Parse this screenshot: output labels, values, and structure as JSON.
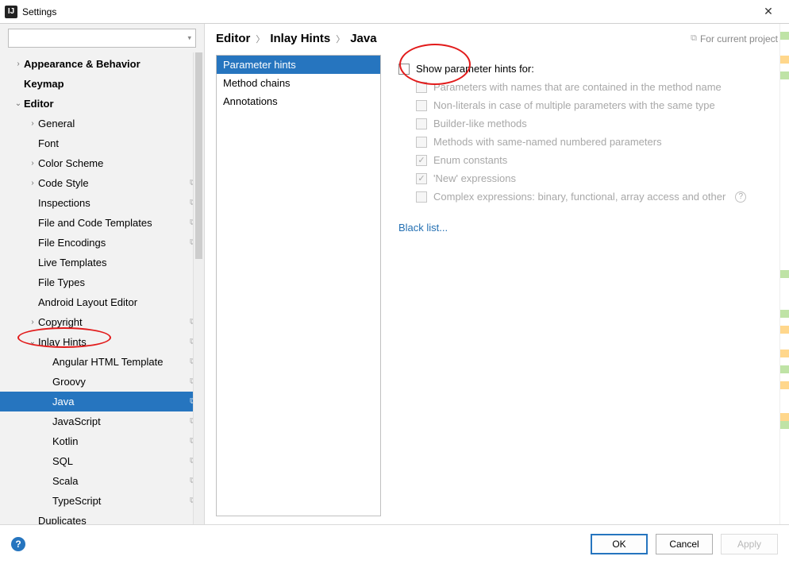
{
  "titlebar": {
    "title": "Settings"
  },
  "search": {
    "placeholder": ""
  },
  "sidebar": {
    "items": [
      {
        "label": "Appearance & Behavior",
        "depth": 0,
        "arrow": "right",
        "bold": true
      },
      {
        "label": "Keymap",
        "depth": 0,
        "bold": true
      },
      {
        "label": "Editor",
        "depth": 0,
        "arrow": "down",
        "bold": true
      },
      {
        "label": "General",
        "depth": 1,
        "arrow": "right"
      },
      {
        "label": "Font",
        "depth": 1
      },
      {
        "label": "Color Scheme",
        "depth": 1,
        "arrow": "right"
      },
      {
        "label": "Code Style",
        "depth": 1,
        "arrow": "right",
        "proj": true
      },
      {
        "label": "Inspections",
        "depth": 1,
        "proj": true
      },
      {
        "label": "File and Code Templates",
        "depth": 1,
        "proj": true
      },
      {
        "label": "File Encodings",
        "depth": 1,
        "proj": true
      },
      {
        "label": "Live Templates",
        "depth": 1
      },
      {
        "label": "File Types",
        "depth": 1
      },
      {
        "label": "Android Layout Editor",
        "depth": 1
      },
      {
        "label": "Copyright",
        "depth": 1,
        "arrow": "right",
        "proj": true
      },
      {
        "label": "Inlay Hints",
        "depth": 1,
        "arrow": "down",
        "proj": true
      },
      {
        "label": "Angular HTML Template",
        "depth": 2,
        "proj": true
      },
      {
        "label": "Groovy",
        "depth": 2,
        "proj": true
      },
      {
        "label": "Java",
        "depth": 2,
        "proj": true,
        "selected": true
      },
      {
        "label": "JavaScript",
        "depth": 2,
        "proj": true
      },
      {
        "label": "Kotlin",
        "depth": 2,
        "proj": true
      },
      {
        "label": "SQL",
        "depth": 2,
        "proj": true
      },
      {
        "label": "Scala",
        "depth": 2,
        "proj": true
      },
      {
        "label": "TypeScript",
        "depth": 2,
        "proj": true
      },
      {
        "label": "Duplicates",
        "depth": 1
      }
    ]
  },
  "breadcrumb": {
    "p0": "Editor",
    "p1": "Inlay Hints",
    "p2": "Java"
  },
  "projectNote": "For current project",
  "categories": [
    {
      "label": "Parameter hints",
      "selected": true
    },
    {
      "label": "Method chains"
    },
    {
      "label": "Annotations"
    }
  ],
  "options": {
    "master": {
      "label": "Show parameter hints for:"
    },
    "subs": [
      {
        "label": "Parameters with names that are contained in the method name",
        "checked": false
      },
      {
        "label": "Non-literals in case of multiple parameters with the same type",
        "checked": false
      },
      {
        "label": "Builder-like methods",
        "checked": false
      },
      {
        "label": "Methods with same-named numbered parameters",
        "checked": false
      },
      {
        "label": "Enum constants",
        "checked": true
      },
      {
        "label": "'New' expressions",
        "checked": true
      },
      {
        "label": "Complex expressions: binary, functional, array access and other",
        "checked": false,
        "help": true
      }
    ],
    "blacklist": "Black list..."
  },
  "footer": {
    "ok": "OK",
    "cancel": "Cancel",
    "apply": "Apply"
  }
}
